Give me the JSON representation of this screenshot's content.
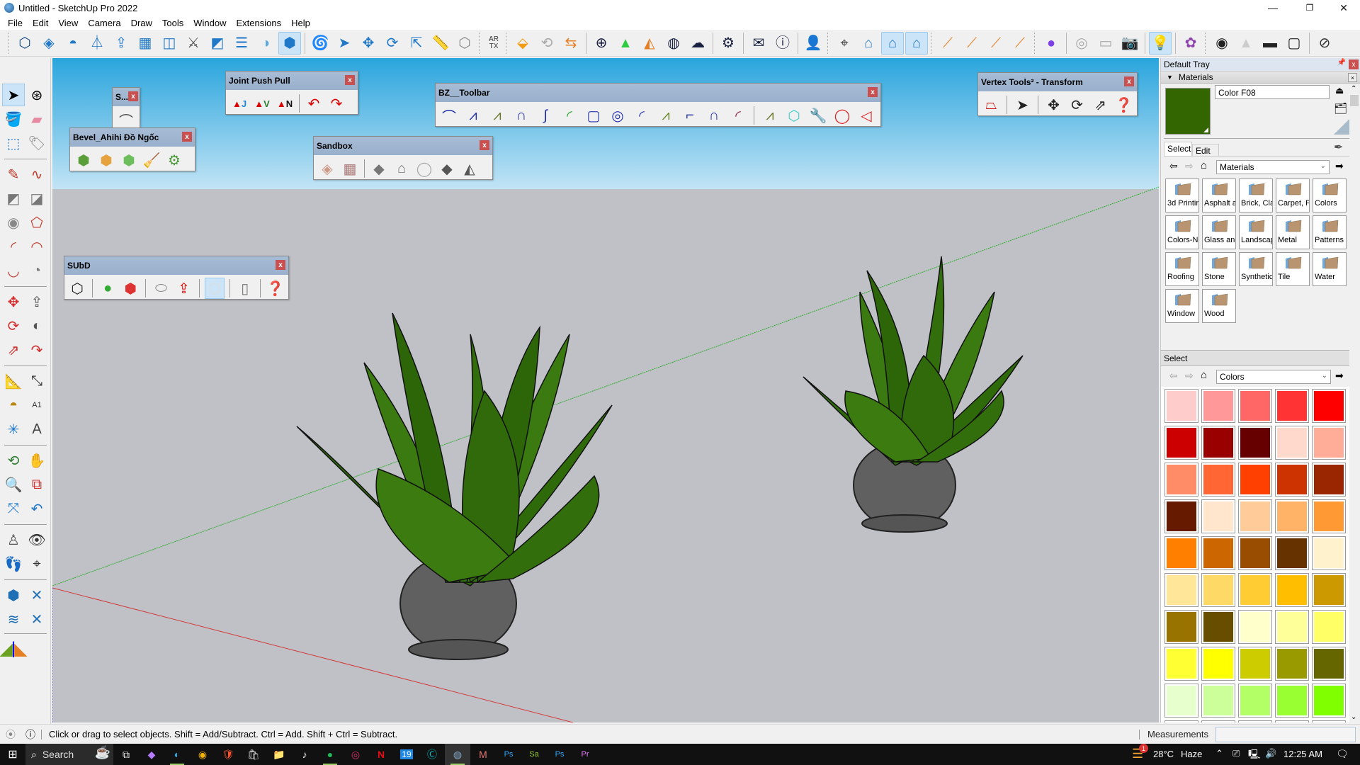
{
  "window": {
    "title": "Untitled - SketchUp Pro 2022",
    "controls": {
      "minimize": "—",
      "restore": "❐",
      "close": "✕"
    }
  },
  "menu": [
    "File",
    "Edit",
    "View",
    "Camera",
    "Draw",
    "Tools",
    "Window",
    "Extensions",
    "Help"
  ],
  "toolbar": {
    "groups": [
      [
        "sketchup-shape-icon",
        "cube-grid-icon",
        "dome-icon",
        "loft-icon",
        "extrude-arrow-icon",
        "grid-plane-icon",
        "offset-face-icon",
        "sword-icon",
        "fold-icon",
        "split-icon",
        "sphere-half-icon",
        "cube-icon-active"
      ],
      [
        "spiral-icon",
        "select-arrow-icon",
        "move-arrows-icon",
        "rotate-icon",
        "scale-icon",
        "ruler-icon",
        "wire-polyhedron-icon"
      ],
      [
        "artx-icon"
      ],
      [
        "enscape-icon",
        "refresh-icon",
        "camera-swap-icon"
      ],
      [
        "add-circle-icon",
        "tree-icon",
        "palette-icon",
        "checker-sphere-icon",
        "cloud-upload-icon"
      ],
      [
        "gears-icon"
      ],
      [
        "mail-icon",
        "info-icon"
      ],
      [
        "user-icon"
      ],
      [
        "orbit-target-icon",
        "house-section-icon",
        "house-blue-icon",
        "house-blue2-icon"
      ],
      [
        "brush-triangle-icon",
        "brush-line-icon",
        "brush-cube-icon",
        "brush-dash-icon"
      ],
      [
        "purple-plugin-icon"
      ],
      [
        "orbit-dim-icon",
        "camera-swap-dim-icon",
        "camera-dim-icon"
      ],
      [
        "light-bulb-icon"
      ],
      [
        "flower-settings-icon"
      ],
      [
        "point-light-icon",
        "spot-cone-icon",
        "line-light-icon",
        "rect-light-icon"
      ],
      [
        "hide-eye-icon"
      ]
    ],
    "artx_label": "AR TX"
  },
  "floating_toolbars": {
    "s_mini": {
      "title": "S..."
    },
    "bevel": {
      "title": "Bevel_Ahihi Đồ Ngốc"
    },
    "joint_push_pull": {
      "title": "Joint Push Pull",
      "labels": [
        "J",
        "V",
        "N"
      ]
    },
    "sandbox": {
      "title": "Sandbox"
    },
    "bz_toolbar": {
      "title": "BZ__Toolbar"
    },
    "vertex_tools": {
      "title": "Vertex Tools² - Transform"
    },
    "subd": {
      "title": "SUbD"
    },
    "close_label": "x"
  },
  "tray": {
    "title": "Default Tray",
    "pin": "📌",
    "close": "x",
    "materials_header": "Materials",
    "current_material": {
      "name": "Color F08",
      "color": "#336600"
    },
    "tabs": [
      "Select",
      "Edit"
    ],
    "active_tab": "Select",
    "library_dropdown": "Materials",
    "folders": [
      "3d Printir",
      "Asphalt a",
      "Brick, Cla",
      "Carpet, F",
      "Colors",
      "Colors-Ni",
      "Glass anc",
      "Landscap",
      "Metal",
      "Patterns",
      "Roofing",
      "Stone",
      "Synthetic",
      "Tile",
      "Water",
      "Window",
      "Wood"
    ],
    "secondary_select_label": "Select",
    "secondary_dropdown": "Colors",
    "colors": [
      "#ffcccc",
      "#ff9999",
      "#ff6666",
      "#ff3333",
      "#ff0000",
      "#cc0000",
      "#990000",
      "#660000",
      "#ffd9cc",
      "#ffad99",
      "#ff8c66",
      "#ff6633",
      "#ff4000",
      "#cc3300",
      "#992600",
      "#661a00",
      "#ffe6cc",
      "#ffcc99",
      "#ffb366",
      "#ff9933",
      "#ff8000",
      "#cc6600",
      "#994d00",
      "#663300",
      "#fff2cc",
      "#ffe699",
      "#ffd966",
      "#ffcc33",
      "#ffbf00",
      "#cc9900",
      "#997300",
      "#664d00",
      "#ffffcc",
      "#ffff99",
      "#ffff66",
      "#ffff33",
      "#ffff00",
      "#cccc00",
      "#999900",
      "#666600",
      "#e6ffcc",
      "#ccff99",
      "#b3ff66",
      "#99ff33",
      "#80ff00",
      "#66cc00",
      "#4d9900",
      "#336600",
      "#ccffcc",
      "#99ff99"
    ]
  },
  "status": {
    "hint": "Click or drag to select objects. Shift = Add/Subtract. Ctrl = Add. Shift + Ctrl = Subtract.",
    "measurements_label": "Measurements",
    "measurements_value": ""
  },
  "taskbar": {
    "search_placeholder": "Search",
    "apps": [
      "task-view",
      "copilot",
      "edge",
      "chrome",
      "brave",
      "store",
      "file-explorer",
      "tiktok",
      "spotify",
      "instagram",
      "netflix",
      "calendar-19",
      "canva",
      "sketchup",
      "app-m",
      "photoshop",
      "sa",
      "photoshop-2",
      "premiere"
    ],
    "weather": {
      "temp": "28°C",
      "condition": "Haze",
      "badge": "1"
    },
    "time": "12:25 AM"
  }
}
